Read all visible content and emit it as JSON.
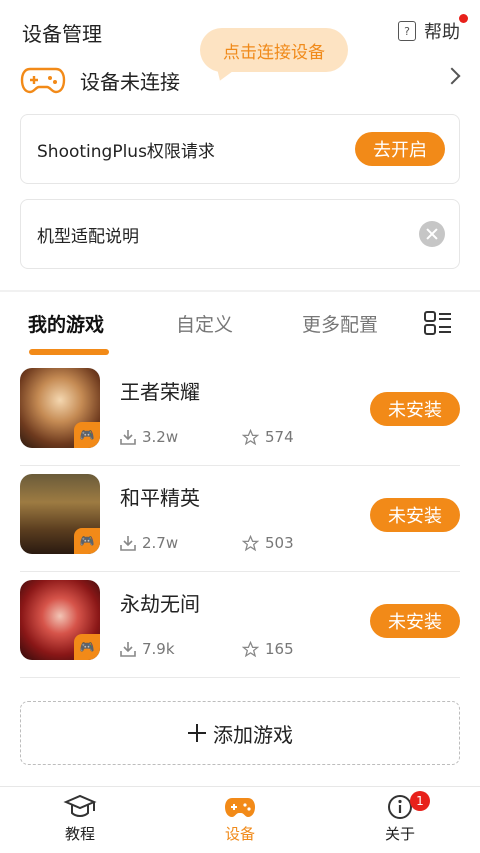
{
  "header": {
    "title": "设备管理",
    "help_label": "帮助",
    "bubble_text": "点击连接设备",
    "device_status": "设备未连接"
  },
  "cards": {
    "permission_text": "ShootingPlus权限请求",
    "permission_button": "去开启",
    "model_text": "机型适配说明"
  },
  "tabs": [
    {
      "label": "我的游戏"
    },
    {
      "label": "自定义"
    },
    {
      "label": "更多配置"
    }
  ],
  "games": [
    {
      "name": "王者荣耀",
      "downloads": "3.2w",
      "stars": "574",
      "button": "未安装"
    },
    {
      "name": "和平精英",
      "downloads": "2.7w",
      "stars": "503",
      "button": "未安装"
    },
    {
      "name": "永劫无间",
      "downloads": "7.9k",
      "stars": "165",
      "button": "未安装"
    }
  ],
  "add_game_label": "添加游戏",
  "bottom_nav": [
    {
      "label": "教程"
    },
    {
      "label": "设备"
    },
    {
      "label": "关于",
      "badge": "1"
    }
  ],
  "colors": {
    "accent": "#f28a18",
    "bubble": "#fde3c2",
    "notification": "#e8211b"
  }
}
